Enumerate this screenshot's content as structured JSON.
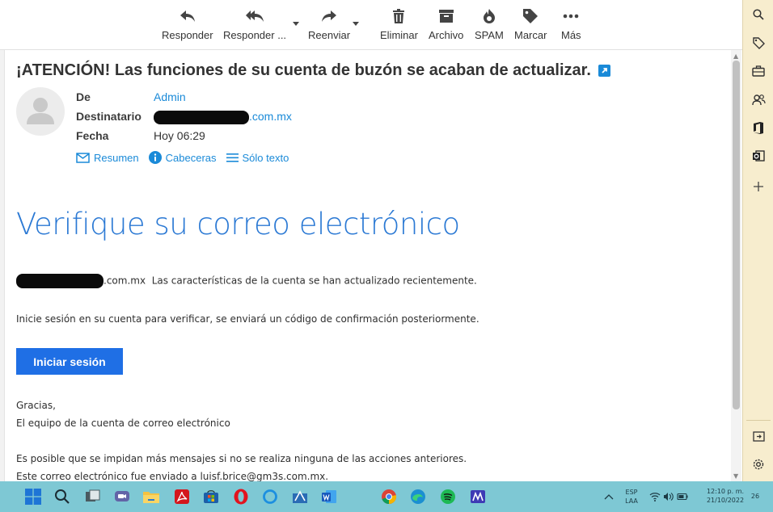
{
  "toolbar": {
    "reply": "Responder",
    "reply_all": "Responder ...",
    "forward": "Reenviar",
    "delete": "Eliminar",
    "archive": "Archivo",
    "spam": "SPAM",
    "mark": "Marcar",
    "more": "Más"
  },
  "message": {
    "subject": "¡ATENCIÓN! Las funciones de su cuenta de buzón se acaban de actualizar.",
    "from_label": "De",
    "from_value": "Admin",
    "to_label": "Destinatario",
    "to_domain": ".com.mx",
    "date_label": "Fecha",
    "date_value": "Hoy 06:29",
    "links": {
      "summary": "Resumen",
      "headers": "Cabeceras",
      "plain": "Sólo texto"
    }
  },
  "body": {
    "title": "Verifique su correo electrónico",
    "line1_domain": ".com.mx",
    "line1_text": "Las características de la cuenta se han actualizado recientemente.",
    "line2": "Inicie sesión en su cuenta para verificar, se enviará un código de confirmación posteriormente.",
    "login_button": "Iniciar sesión",
    "thanks": "Gracias,",
    "team": "El equipo de la cuenta de correo electrónico",
    "warning": "Es posible que se impidan más mensajes si no se realiza ninguna de las acciones anteriores.",
    "sent_to": "Este correo electrónico fue enviado a   luisf.brice@gm3s.com.mx."
  },
  "taskbar": {
    "language_top": "ESP",
    "language_bottom": "LAA",
    "time": "12:10 p. m.",
    "date": "21/10/2022",
    "notification_count": "26"
  },
  "colors": {
    "link": "#1a8ad8",
    "title_blue": "#2b79d4",
    "button_blue": "#1f6fe5",
    "sidebar": "#f7edce",
    "taskbar": "#7ec8d4"
  }
}
